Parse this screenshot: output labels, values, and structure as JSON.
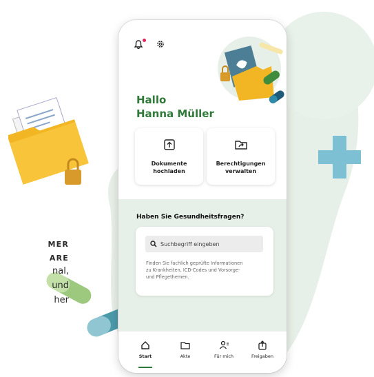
{
  "colors": {
    "brand_green": "#2f7a39",
    "background_mint": "#e7f0e8",
    "accent_teal": "#7dc0d3",
    "notification_red": "#e3245a"
  },
  "left_text": {
    "line1": "MER",
    "line2": "ARE",
    "line3": "nal,",
    "line4": "und",
    "line5": "her"
  },
  "header": {
    "bell_icon": "bell-icon",
    "settings_icon": "gear-icon"
  },
  "greeting": {
    "line1": "Hallo",
    "line2": "Hanna Müller"
  },
  "actions": [
    {
      "label_line1": "Dokumente",
      "label_line2": "hochladen",
      "icon": "upload-icon"
    },
    {
      "label_line1": "Berechtigungen",
      "label_line2": "verwalten",
      "icon": "folder-share-icon"
    }
  ],
  "health": {
    "title": "Haben Sie Gesundheitsfragen?",
    "search_placeholder": "Suchbegriff eingeben",
    "desc_line1": "Finden Sie fachlich geprüfte Informationen",
    "desc_line2": "zu Krankheiten, ICD-Codes und Vorsorge-",
    "desc_line3": "und Pflegethemen."
  },
  "tabs": [
    {
      "label": "Start",
      "icon": "home-icon",
      "active": true
    },
    {
      "label": "Akte",
      "icon": "folder-icon",
      "active": false
    },
    {
      "label": "Für mich",
      "icon": "person-icon",
      "active": false
    },
    {
      "label": "Freigaben",
      "icon": "share-icon",
      "active": false
    }
  ]
}
